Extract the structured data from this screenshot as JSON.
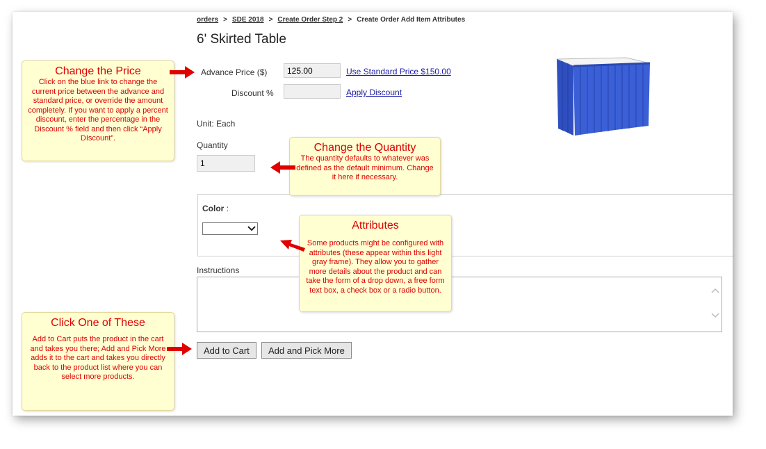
{
  "breadcrumb": {
    "items": [
      "orders",
      "SDE 2018",
      "Create Order Step 2"
    ],
    "current": "Create Order Add Item Attributes",
    "separator": ">"
  },
  "product": {
    "title": "6' Skirted Table",
    "image_alt": "table-skirt-icon"
  },
  "price": {
    "label": "Advance  Price  ($)",
    "value": "125.00",
    "standard_link": "Use Standard Price $150.00"
  },
  "discount": {
    "label": "Discount %",
    "value": "",
    "apply_link": "Apply Discount"
  },
  "unit": {
    "text": "Unit:  Each"
  },
  "quantity": {
    "label": "Quantity",
    "value": "1"
  },
  "attributes": {
    "color_label": "Color",
    "color_colon": ":",
    "color_selected": ""
  },
  "instructions": {
    "label": "Instructions",
    "value": ""
  },
  "buttons": {
    "add_to_cart": "Add to Cart",
    "add_and_pick_more": "Add and Pick More"
  },
  "callouts": {
    "price": {
      "title": "Change the Price",
      "body": "Click on the blue link to change the current price between the advance and standard price, or override the amount completely.  If you want to apply a percent discount, enter the percentage in the Discount % field and then click “Apply DIscount”."
    },
    "quantity": {
      "title": "Change the Quantity",
      "body": "The quantity defaults to whatever was defined as the default minimum. Change it here if necessary."
    },
    "attributes": {
      "title": "Attributes",
      "body": "Some products might be configured with attributes (these appear within this light gray frame).  They allow you to gather more details about the product and can take the form of a drop down, a free form text box, a check box or a radio button."
    },
    "click": {
      "title": "Click One of These",
      "body": "Add to Cart puts the product in the cart and takes you there; Add and Pick More adds it to the cart and takes you directly back to the product list where you can select more products."
    }
  },
  "colors": {
    "link": "#1a1aa6",
    "callout_bg": "#ffffd2",
    "callout_text": "#e00000",
    "arrow": "#e00000",
    "skirt": "#3355cc"
  }
}
